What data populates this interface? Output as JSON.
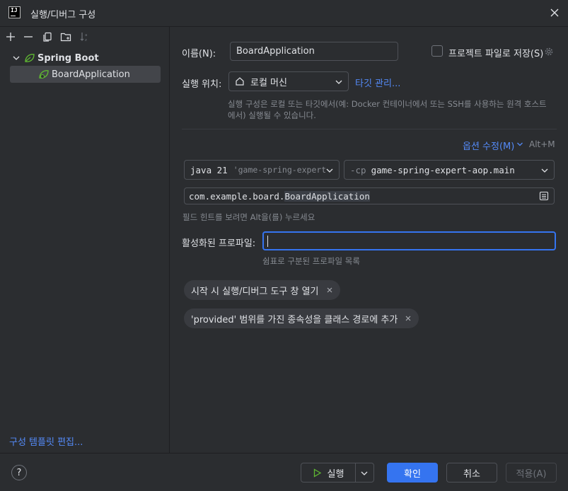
{
  "window": {
    "title": "실행/디버그 구성"
  },
  "tree": {
    "group_label": "Spring Boot",
    "items": [
      {
        "label": "BoardApplication"
      }
    ],
    "template_link": "구성 템플릿 편집..."
  },
  "form": {
    "name_label": "이름(N):",
    "name_value": "BoardApplication",
    "store_label": "프로젝트 파일로 저장(S)",
    "run_on_label": "실행 위치:",
    "run_on_value": "로컬 머신",
    "manage_targets": "타깃 관리...",
    "run_on_hint_1": "실행 구성은 로컬 또는 타깃에서(예: Docker 컨테이너에서 또는 SSH를 사용하는 원격 호스트",
    "run_on_hint_2": "에서) 실행될 수 있습니다.",
    "modify_options": "옵션 수정(M)",
    "modify_shortcut": "Alt+M",
    "jdk_version": "java 21",
    "jdk_module": "'game-spring-expert",
    "cp_flag": "-cp",
    "cp_module": "game-spring-expert-aop.main",
    "main_class_prefix": "com.example.board.",
    "main_class_name": "BoardApplication",
    "field_hint": "필드 힌트를 보려면 Alt을(를) 누르세요",
    "profiles_label": "활성화된 프로파일:",
    "profiles_value": "",
    "profiles_hint": "쉼표로 구분된 프로파일 목록",
    "chips": [
      {
        "label": "시작 시 실행/디버그 도구 창 열기"
      },
      {
        "label": "'provided' 범위를 가진 종속성을 클래스 경로에 추가"
      }
    ]
  },
  "footer": {
    "help": "?",
    "run": "실행",
    "ok": "확인",
    "cancel": "취소",
    "apply": "적용(A)"
  },
  "colors": {
    "background": "#2b2d30",
    "accent": "#3574f0",
    "link": "#548af7",
    "spring_green": "#5fb832"
  }
}
